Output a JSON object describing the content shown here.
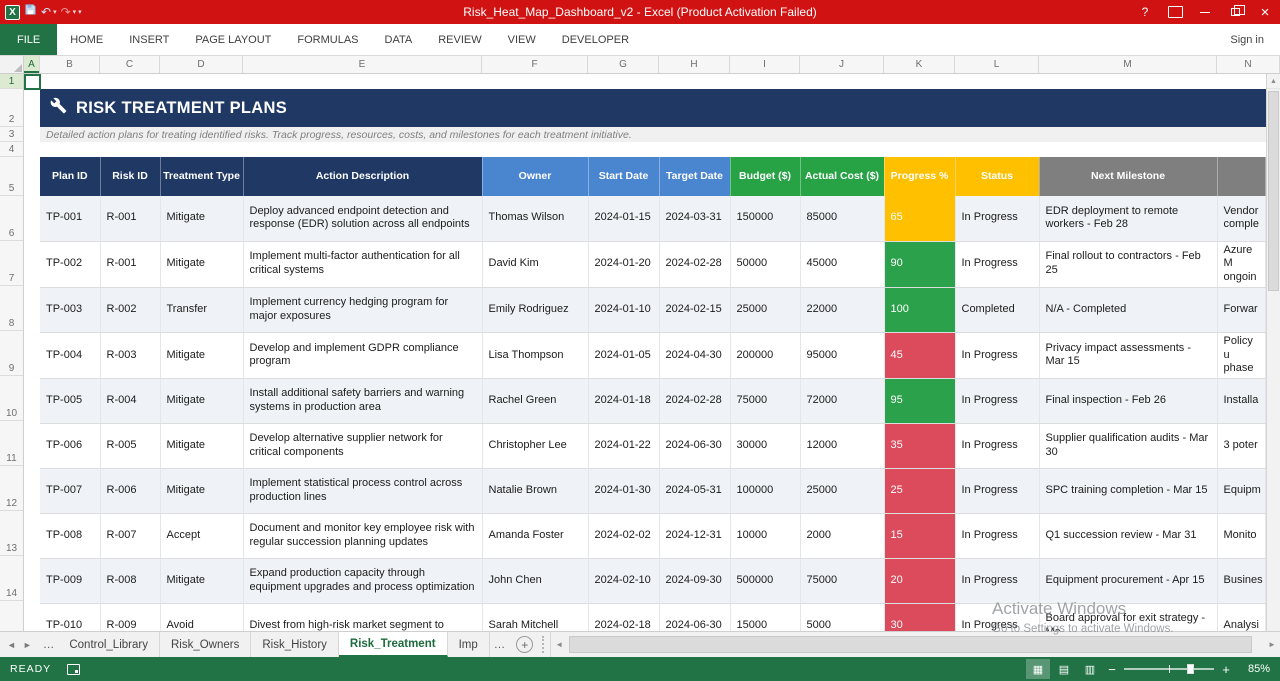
{
  "window": {
    "title": "Risk_Heat_Map_Dashboard_v2 -  Excel (Product Activation Failed)",
    "controls": {
      "help": "?",
      "close": "×"
    }
  },
  "ribbon": {
    "tabs": [
      {
        "label": "FILE",
        "active": true
      },
      {
        "label": "HOME",
        "active": false
      },
      {
        "label": "INSERT",
        "active": false
      },
      {
        "label": "PAGE LAYOUT",
        "active": false
      },
      {
        "label": "FORMULAS",
        "active": false
      },
      {
        "label": "DATA",
        "active": false
      },
      {
        "label": "REVIEW",
        "active": false
      },
      {
        "label": "VIEW",
        "active": false
      },
      {
        "label": "DEVELOPER",
        "active": false
      }
    ],
    "sign_in": "Sign in"
  },
  "grid": {
    "columns": [
      "A",
      "B",
      "C",
      "D",
      "E",
      "F",
      "G",
      "H",
      "I",
      "J",
      "K",
      "L",
      "M",
      "N"
    ],
    "rows": [
      "1",
      "2",
      "3",
      "4",
      "5",
      "6",
      "7",
      "8",
      "9",
      "10",
      "11",
      "12",
      "13",
      "14"
    ],
    "selected_cell": "A1"
  },
  "sheet": {
    "banner": {
      "icon": "wrench-icon",
      "title": "RISK TREATMENT PLANS"
    },
    "subtitle": "Detailed action plans for treating identified risks. Track progress, resources, costs, and milestones for each treatment initiative.",
    "table": {
      "headers": [
        "Plan ID",
        "Risk ID",
        "Treatment Type",
        "Action Description",
        "Owner",
        "Start Date",
        "Target Date",
        "Budget ($)",
        "Actual Cost ($)",
        "Progress %",
        "Status",
        "Next Milestone"
      ],
      "rows": [
        {
          "plan_id": "TP-001",
          "risk_id": "R-001",
          "type": "Mitigate",
          "description": "Deploy advanced endpoint detection and response (EDR) solution across all endpoints",
          "owner": "Thomas Wilson",
          "start": "2024-01-15",
          "target": "2024-03-31",
          "budget": "150000",
          "actual": "85000",
          "progress": "65",
          "progress_color": "yellow",
          "status": "In Progress",
          "milestone": "EDR deployment to remote workers - Feb 28",
          "overflow": "Vendor\ncomple"
        },
        {
          "plan_id": "TP-002",
          "risk_id": "R-001",
          "type": "Mitigate",
          "description": "Implement multi-factor authentication for all critical systems",
          "owner": "David Kim",
          "start": "2024-01-20",
          "target": "2024-02-28",
          "budget": "50000",
          "actual": "45000",
          "progress": "90",
          "progress_color": "green",
          "status": "In Progress",
          "milestone": "Final rollout to contractors - Feb 25",
          "overflow": "Azure M\nongoin"
        },
        {
          "plan_id": "TP-003",
          "risk_id": "R-002",
          "type": "Transfer",
          "description": "Implement currency hedging program for major exposures",
          "owner": "Emily Rodriguez",
          "start": "2024-01-10",
          "target": "2024-02-15",
          "budget": "25000",
          "actual": "22000",
          "progress": "100",
          "progress_color": "green",
          "status": "Completed",
          "milestone": "N/A - Completed",
          "overflow": "Forwar"
        },
        {
          "plan_id": "TP-004",
          "risk_id": "R-003",
          "type": "Mitigate",
          "description": "Develop and implement GDPR compliance program",
          "owner": "Lisa Thompson",
          "start": "2024-01-05",
          "target": "2024-04-30",
          "budget": "200000",
          "actual": "95000",
          "progress": "45",
          "progress_color": "red",
          "status": "In Progress",
          "milestone": "Privacy impact assessments - Mar 15",
          "overflow": "Policy u\nphase"
        },
        {
          "plan_id": "TP-005",
          "risk_id": "R-004",
          "type": "Mitigate",
          "description": "Install additional safety barriers and warning systems in production area",
          "owner": "Rachel Green",
          "start": "2024-01-18",
          "target": "2024-02-28",
          "budget": "75000",
          "actual": "72000",
          "progress": "95",
          "progress_color": "green",
          "status": "In Progress",
          "milestone": "Final inspection - Feb 26",
          "overflow": "Installa"
        },
        {
          "plan_id": "TP-006",
          "risk_id": "R-005",
          "type": "Mitigate",
          "description": "Develop alternative supplier network for critical components",
          "owner": "Christopher Lee",
          "start": "2024-01-22",
          "target": "2024-06-30",
          "budget": "30000",
          "actual": "12000",
          "progress": "35",
          "progress_color": "red",
          "status": "In Progress",
          "milestone": "Supplier qualification audits - Mar 30",
          "overflow": "3 poter"
        },
        {
          "plan_id": "TP-007",
          "risk_id": "R-006",
          "type": "Mitigate",
          "description": "Implement statistical process control across production lines",
          "owner": "Natalie Brown",
          "start": "2024-01-30",
          "target": "2024-05-31",
          "budget": "100000",
          "actual": "25000",
          "progress": "25",
          "progress_color": "red",
          "status": "In Progress",
          "milestone": "SPC training completion - Mar 15",
          "overflow": "Equipm"
        },
        {
          "plan_id": "TP-008",
          "risk_id": "R-007",
          "type": "Accept",
          "description": "Document and monitor key employee risk with regular succession planning updates",
          "owner": "Amanda Foster",
          "start": "2024-02-02",
          "target": "2024-12-31",
          "budget": "10000",
          "actual": "2000",
          "progress": "15",
          "progress_color": "red",
          "status": "In Progress",
          "milestone": "Q1 succession review - Mar 31",
          "overflow": "Monito"
        },
        {
          "plan_id": "TP-009",
          "risk_id": "R-008",
          "type": "Mitigate",
          "description": "Expand production capacity through equipment upgrades and process optimization",
          "owner": "John Chen",
          "start": "2024-02-10",
          "target": "2024-09-30",
          "budget": "500000",
          "actual": "75000",
          "progress": "20",
          "progress_color": "red",
          "status": "In Progress",
          "milestone": "Equipment procurement - Apr 15",
          "overflow": "Busines"
        },
        {
          "plan_id": "TP-010",
          "risk_id": "R-009",
          "type": "Avoid",
          "description": "Divest from high-risk market segment to",
          "owner": "Sarah Mitchell",
          "start": "2024-02-18",
          "target": "2024-06-30",
          "budget": "15000",
          "actual": "5000",
          "progress": "30",
          "progress_color": "red",
          "status": "In Progress",
          "milestone": "Board approval for exit strategy - Ma",
          "overflow": "Analysi"
        }
      ]
    }
  },
  "sheet_tabs": {
    "tabs": [
      {
        "label": "Control_Library",
        "active": false
      },
      {
        "label": "Risk_Owners",
        "active": false
      },
      {
        "label": "Risk_History",
        "active": false
      },
      {
        "label": "Risk_Treatment",
        "active": true
      },
      {
        "label": "Imp",
        "active": false
      }
    ]
  },
  "status_bar": {
    "mode": "READY",
    "zoom": "85%"
  },
  "watermark": {
    "line1": "Activate Windows",
    "line2": "Go to Settings to activate Windows."
  },
  "icons": {
    "excel_logo": "X",
    "undo": "↶",
    "redo": "↷",
    "dropdown": "▾",
    "scroll_up": "▲",
    "tab_nav_left": "◄",
    "tab_nav_right": "►",
    "ellipsis": "…",
    "add_sheet": "+",
    "hscroll_left": "◄",
    "hscroll_right": "►",
    "view_normal": "▦",
    "view_layout": "▤",
    "view_break": "▥",
    "zoom_out": "−",
    "zoom_in": "+"
  },
  "colors": {
    "titlebar_red": "#D01212",
    "excel_green": "#217346",
    "banner_navy": "#1F3864",
    "header_blue": "#4A85D0",
    "header_green": "#27A346",
    "header_gold": "#FFC000",
    "header_gray": "#7F7F7F",
    "progress_red": "#DB4B5C",
    "progress_green": "#2BA14B",
    "progress_yellow": "#FFC000",
    "row_stripe": "#EFF2F6"
  }
}
